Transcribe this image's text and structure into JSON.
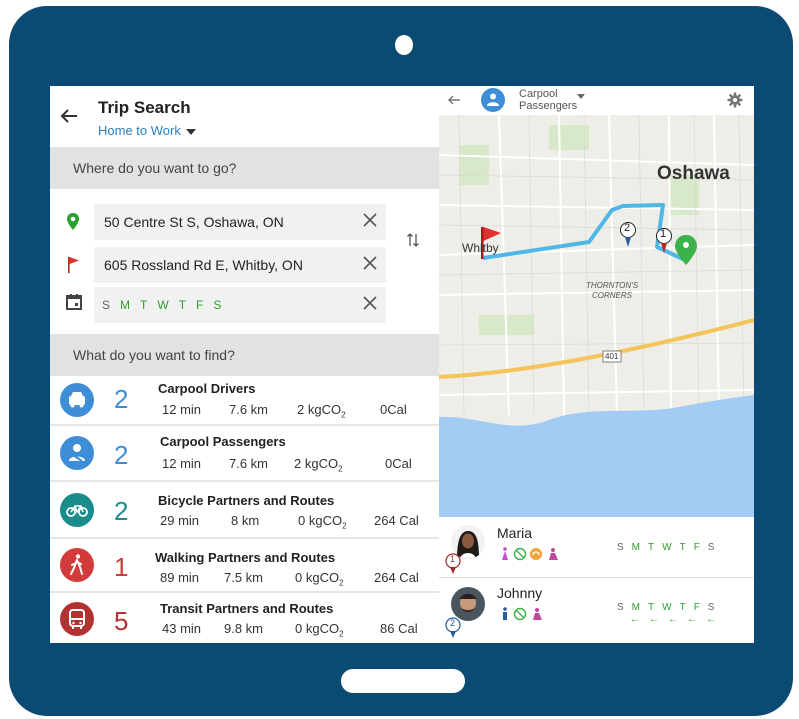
{
  "left": {
    "title": "Trip Search",
    "subtitle": "Home to Work",
    "where_label": "Where do you want to go?",
    "origin": "50 Centre St S, Oshawa, ON",
    "destination": "605 Rossland Rd E, Whitby, ON",
    "days": [
      "S",
      "M",
      "T",
      "W",
      "T",
      "F",
      "S"
    ],
    "find_label": "What do you want to find?",
    "results": [
      {
        "title": "Carpool Drivers",
        "count": "2",
        "time": "12 min",
        "dist": "7.6 km",
        "co2": "2 kgCO",
        "cal": "0Cal",
        "color": "#3d8ed6"
      },
      {
        "title": "Carpool Passengers",
        "count": "2",
        "time": "12 min",
        "dist": "7.6 km",
        "co2": "2 kgCO",
        "cal": "0Cal",
        "color": "#3d8ed6"
      },
      {
        "title": "Bicycle Partners and Routes",
        "count": "2",
        "time": "29 min",
        "dist": "8 km",
        "co2": "0 kgCO",
        "cal": "264 Cal",
        "color": "#1a8c8c"
      },
      {
        "title": "Walking Partners and Routes",
        "count": "1",
        "time": "89 min",
        "dist": "7.5 km",
        "co2": "0 kgCO",
        "cal": "264 Cal",
        "color": "#d23b3b"
      },
      {
        "title": "Transit Partners and Routes",
        "count": "5",
        "time": "43 min",
        "dist": "9.8 km",
        "co2": "0 kgCO",
        "cal": "86 Cal",
        "color": "#b23232"
      }
    ],
    "co2_sub": "2"
  },
  "right": {
    "mode_title": "Carpool",
    "mode_sub": "Passengers",
    "map": {
      "city_label": "Oshawa",
      "town_label": "Whitby",
      "area_label_1": "THORNTON'S",
      "area_label_2": "CORNERS",
      "highway": "401",
      "marker1": "1",
      "marker2": "2"
    },
    "people": [
      {
        "name": "Maria",
        "badge": "1",
        "days": [
          "S",
          "M",
          "T",
          "W",
          "T",
          "F",
          "S"
        ]
      },
      {
        "name": "Johnny",
        "badge": "2",
        "days": [
          "S",
          "M",
          "T",
          "W",
          "T",
          "F",
          "S"
        ],
        "arrows": [
          "←",
          "←",
          "←",
          "←",
          "←"
        ]
      }
    ]
  },
  "colors": {
    "frame": "#0b4a72",
    "accent": "#2a7fc0",
    "green": "#2ca02c",
    "route": "#4fb6e8"
  }
}
